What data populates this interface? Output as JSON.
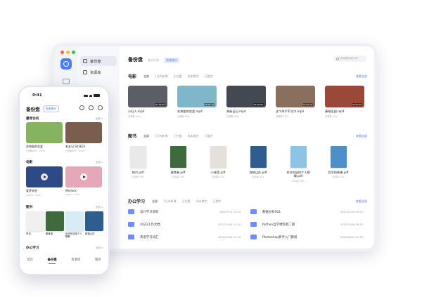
{
  "app": {
    "title": "备份盘",
    "subtitle": "备份目录",
    "mode_badge": "智能模式"
  },
  "colors": {
    "accent": "#4b7bff",
    "folder": "#6e8dff"
  },
  "sidebar": {
    "items": [
      {
        "label": "备份盘",
        "icon": "drive-icon"
      },
      {
        "label": "资源库",
        "icon": "library-icon"
      }
    ]
  },
  "search": {
    "placeholder": "搜索备份盘文件"
  },
  "sections": {
    "movies": {
      "title": "电影",
      "chips": [
        "全部",
        "1日内新增",
        "正在看",
        "尚未看完",
        "已看完"
      ],
      "more": "查看全部",
      "items": [
        {
          "name": "小妇人.mp4",
          "meta": "已观看 20%",
          "duration": "02:14:55",
          "color": "#5b5e66"
        },
        {
          "name": "花束般的恋爱.mp4",
          "meta": "已观看 60%",
          "duration": "02:04:10",
          "color": "#7fb6c9"
        },
        {
          "name": "海街日记.mp4",
          "meta": "已观看 40%",
          "duration": "02:08:00",
          "color": "#444950"
        },
        {
          "name": "这个杀手不太冷.mp4",
          "meta": "已观看 70%",
          "duration": "01:50:13",
          "color": "#8a6f5c"
        },
        {
          "name": "康顿庄园.mp4",
          "meta": "已观看 24%",
          "duration": "02:01:00",
          "color": "#9a4838"
        }
      ]
    },
    "books": {
      "title": "图书",
      "chips": [
        "全部",
        "1日内新增",
        "正在看",
        "尚未看完",
        "已看完"
      ],
      "more": "查看全部",
      "items": [
        {
          "name": "斜爪.pdf",
          "meta": "已阅读 34%",
          "color": "#e9e9ea"
        },
        {
          "name": "美食者.pdf",
          "meta": "已阅读 24%",
          "color": "#3f6a3d"
        },
        {
          "name": "小林菜.pdf",
          "meta": "已阅读 17%",
          "color": "#e6e0da"
        },
        {
          "name": "辞锁山庄.pdf",
          "meta": "已阅读 42%",
          "color": "#2f5e8e"
        },
        {
          "name": "也许你该找个人聊聊.pdf",
          "meta": "已阅读 22%",
          "color": "#8fc3e6"
        },
        {
          "name": "哲学的故事.pdf",
          "meta": "已阅读 32%",
          "color": "#4f8fc8"
        }
      ]
    },
    "office": {
      "title": "办公学习",
      "chips": [
        "全部",
        "1日内新增",
        "正在看",
        "尚未看完",
        "已看完"
      ],
      "more": "查看全部",
      "files": [
        {
          "name": "设计学习资料",
          "date": "2022/7/12 15:22"
        },
        {
          "name": "数据分析SQL",
          "date": "2022/10/06 09:23"
        },
        {
          "name": "2023工作文档",
          "date": "2022/10/04 12:32"
        },
        {
          "name": "Python自学材料第二期",
          "date": "2022/10/06 16:32"
        },
        {
          "name": "英语学习词汇",
          "date": "2022/10/24 10:30"
        },
        {
          "name": "Photoshop新手入门教程",
          "date": "2022/08/24 12:30"
        }
      ]
    }
  },
  "phone": {
    "time": "9:41",
    "title": "备份盘",
    "badge": "智能模式",
    "recent": {
      "title": "最常访问",
      "more": "全部 >",
      "items": [
        {
          "name": "花束般的恋爱",
          "meta": "已观看60% · 10:03",
          "color": "#86b35f"
        },
        {
          "name": "老友记 S03E21",
          "meta": "已观看60% · 10:25",
          "color": "#7b5d4d"
        }
      ]
    },
    "movies": {
      "title": "电影",
      "more": "全部 >",
      "items": [
        {
          "name": "爱梦米亚",
          "meta": "2022/7 · 4.2G",
          "color": "#2e4a86"
        },
        {
          "name": "Merlock",
          "meta": "2022/7 · 2.1G",
          "color": "#e4a8b9"
        }
      ]
    },
    "books": {
      "title": "图书",
      "more": "全部 >",
      "items": [
        {
          "name": "鲁迅",
          "color": "#f0f0f0"
        },
        {
          "name": "美食者",
          "color": "#3f6a3d"
        },
        {
          "name": "也许你该找个人聊聊",
          "color": "#d8ecf6"
        },
        {
          "name": "辞锁山庄",
          "color": "#2f5e8e"
        }
      ]
    },
    "office": {
      "title": "办公学习",
      "more": "全部 >"
    },
    "tabs": [
      "首页",
      "备份盘",
      "资源库",
      "我的"
    ]
  }
}
